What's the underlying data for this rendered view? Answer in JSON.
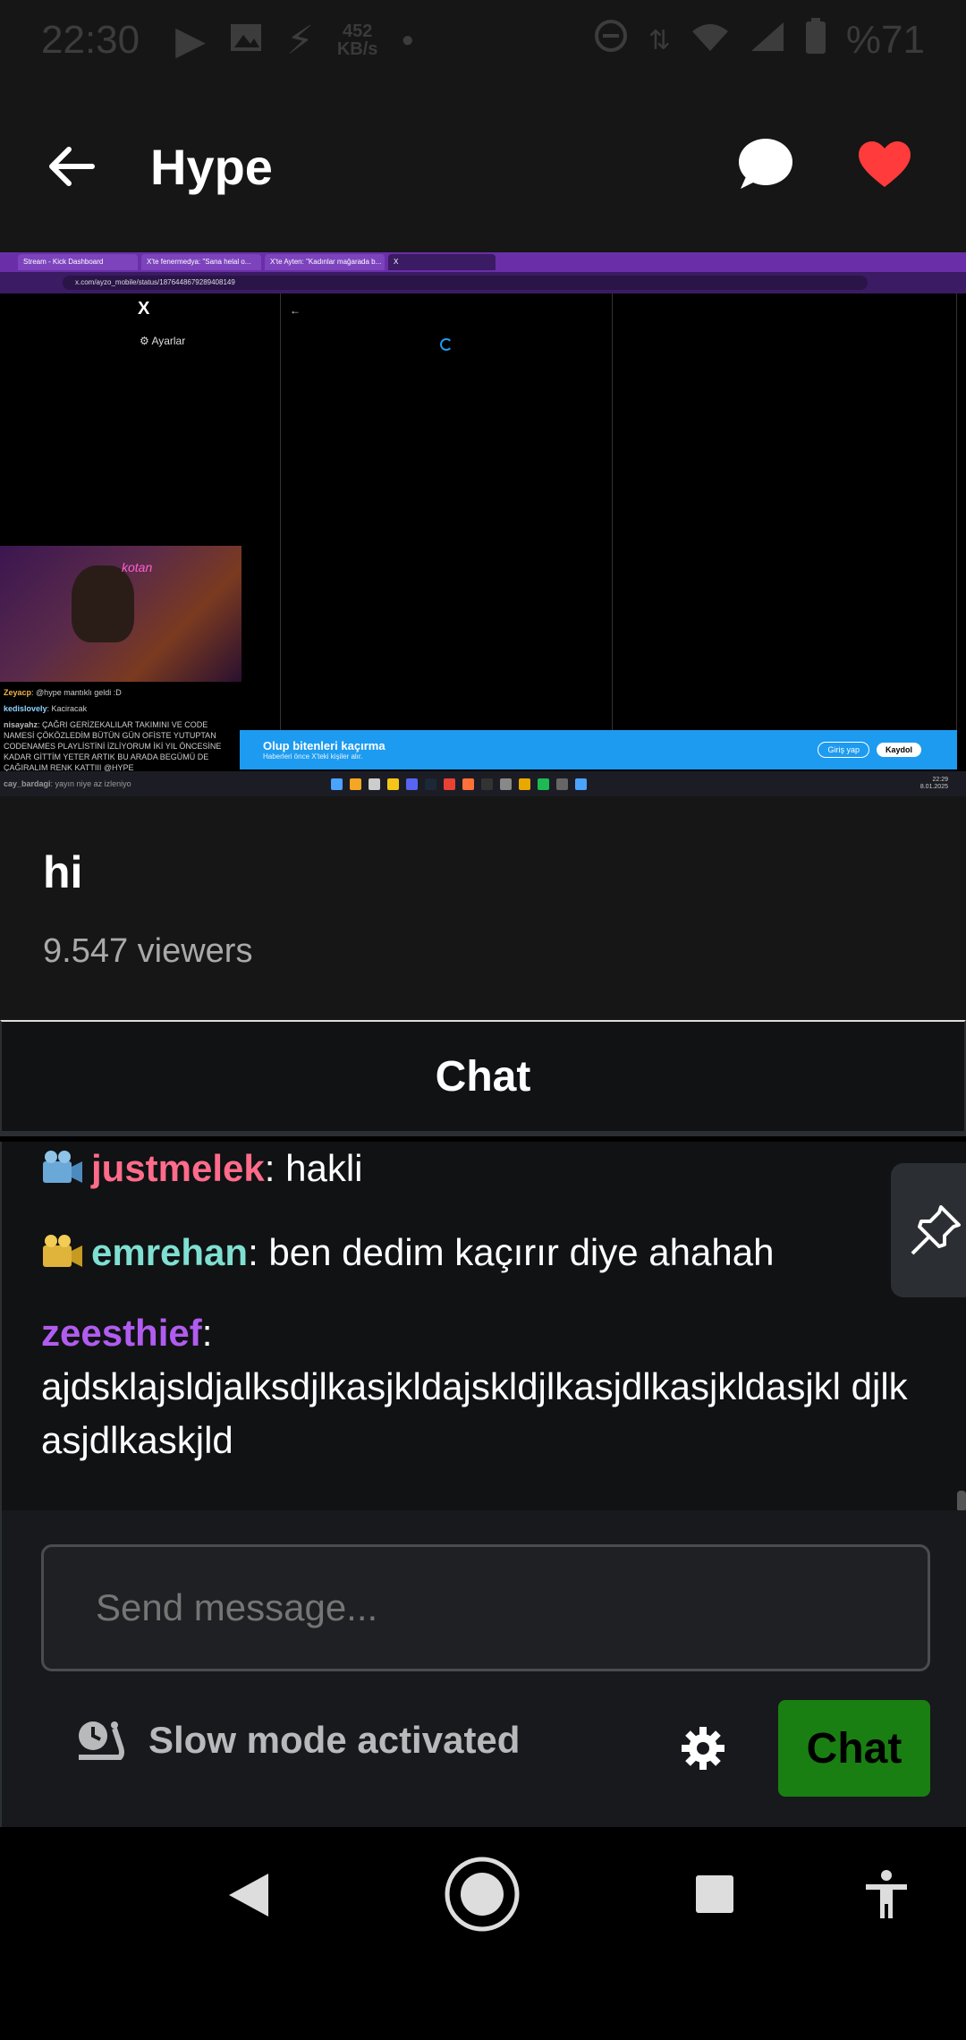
{
  "status_bar": {
    "time": "22:30",
    "net_speed_value": "452",
    "net_speed_unit": "KB/s",
    "battery": "%71",
    "signal_label": "4"
  },
  "app_bar": {
    "title": "Hype"
  },
  "stream_video": {
    "browser_tabs": [
      "Stream - Kick Dashboard",
      "X'te fenermedya: \"Sana helal o...",
      "X'te Ayten: \"Kadınlar mağarada b...",
      "X"
    ],
    "url": "x.com/ayzo_mobile/status/1876448679289408149",
    "x_sidebar_settings": "Ayarlar",
    "x_logo": "X",
    "cam_neon": "kotan",
    "mini_chat": [
      {
        "user": "Zeyacp",
        "text": "@hype mantıklı geldi :D"
      },
      {
        "user": "kedislovely",
        "text": "Kaciracak"
      },
      {
        "user": "nisayahz",
        "text": "ÇAĞRI GERİZEKALILAR TAKIMINI VE CODE NAMESİ ÇÖKÖZLEDİM BÜTÜN GÜN OFİSTE YUTUPTAN CODENAMES PLAYLİSTİNİ İZLİYORUM İKİ YIL ÖNCESİNE KADAR GİTTİM YETER ARTIK BU ARADA BEGÜMÜ DE ÇAĞIRALIM RENK KATTIII @HYPE"
      },
      {
        "user": "cay_bardagi",
        "text": "yayın niye az izleniyo"
      }
    ],
    "banner_title": "Olup bitenleri kaçırma",
    "banner_subtitle": "Haberleri önce X'teki kişiler alır.",
    "banner_login": "Giriş yap",
    "banner_signup": "Kaydol",
    "taskbar_clock": "22:29",
    "taskbar_date": "8.01.2025"
  },
  "stream_info": {
    "title": "hi",
    "viewers": "9.547 viewers"
  },
  "chat": {
    "header": "Chat",
    "messages": [
      {
        "user": "justmelek",
        "sep": ":",
        "text": " hakli",
        "color": "#ff6b8a",
        "badge": "video-camera-badge"
      },
      {
        "user": "emrehan",
        "sep": ":",
        "text": " ben dedim kaçırır diye ahahah",
        "color": "#7fe0d2",
        "badge": "film-camera-badge"
      },
      {
        "user": "zeesthief",
        "sep": ":",
        "text": "ajdsklajsldjalksdjlkasjkldajskldjlkasjdlkasjkldasjkl djlkasjdlkaskjld",
        "color": "#b15cf0",
        "badge": ""
      }
    ],
    "input_placeholder": "Send message...",
    "slow_mode": "Slow mode activated",
    "send_button": "Chat"
  },
  "colors": {
    "accent_red": "#ff3b3b",
    "chat_button": "#1a7f12"
  }
}
